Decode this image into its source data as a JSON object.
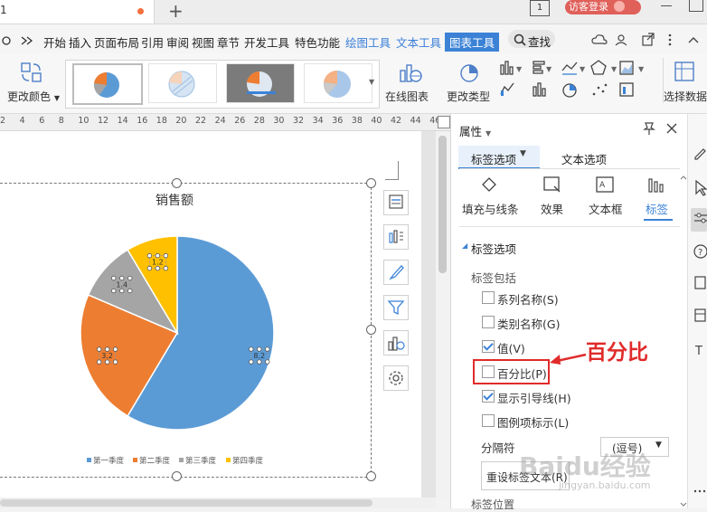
{
  "titlebar": {
    "doc_tab_num": "1",
    "new_tab": "+",
    "page_indicator": "1",
    "login_label": "访客登录"
  },
  "menu": {
    "items": [
      "开始",
      "插入",
      "页面布局",
      "引用",
      "审阅",
      "视图",
      "章节",
      "开发工具",
      "特色功能"
    ],
    "drawing_tools": "绘图工具",
    "text_tools": "文本工具",
    "chart_tools": "图表工具",
    "search": "查找"
  },
  "ribbon": {
    "change_color": "更改颜色",
    "online_chart": "在线图表",
    "change_type": "更改类型",
    "select_data": "选择数据"
  },
  "ruler": {
    "ticks": [
      "2",
      "4",
      "6",
      "8",
      "10",
      "12",
      "14",
      "16",
      "18",
      "20",
      "22",
      "24",
      "26",
      "28",
      "30",
      "32",
      "34",
      "36",
      "38",
      "40",
      "42",
      "44",
      "46"
    ]
  },
  "chart": {
    "title": "销售额",
    "data_labels": [
      "8.2",
      "3.2",
      "1.4",
      "1.2"
    ]
  },
  "chart_data": {
    "type": "pie",
    "title": "销售额",
    "categories": [
      "第一季度",
      "第二季度",
      "第三季度",
      "第四季度"
    ],
    "values": [
      8.2,
      3.2,
      1.4,
      1.2
    ],
    "legend_position": "bottom",
    "colors": [
      "#5b9bd5",
      "#ed7d31",
      "#a5a5a5",
      "#ffc000"
    ]
  },
  "pane": {
    "title": "属性",
    "tab_label_options": "标签选项",
    "tab_text_options": "文本选项",
    "sub_tabs": [
      "填充与线条",
      "效果",
      "文本框",
      "标签"
    ],
    "section_title": "标签选项",
    "label_includes": "标签包括",
    "options": [
      {
        "label": "系列名称(S)",
        "checked": false
      },
      {
        "label": "类别名称(G)",
        "checked": false
      },
      {
        "label": "值(V)",
        "checked": true
      },
      {
        "label": "百分比(P)",
        "checked": false
      },
      {
        "label": "显示引导线(H)",
        "checked": true
      },
      {
        "label": "图例项标示(L)",
        "checked": false
      }
    ],
    "separator_label": "分隔符",
    "separator_value": "(逗号)",
    "reset_button": "重设标签文本(R)",
    "label_position": "标签位置"
  },
  "annotation": {
    "callout": "百分比"
  },
  "watermark": {
    "brand": "Baidu经验",
    "url": "jingyan.baidu.com"
  },
  "colors": {
    "accent": "#3b82d6",
    "callout_red": "#e02b2b"
  }
}
